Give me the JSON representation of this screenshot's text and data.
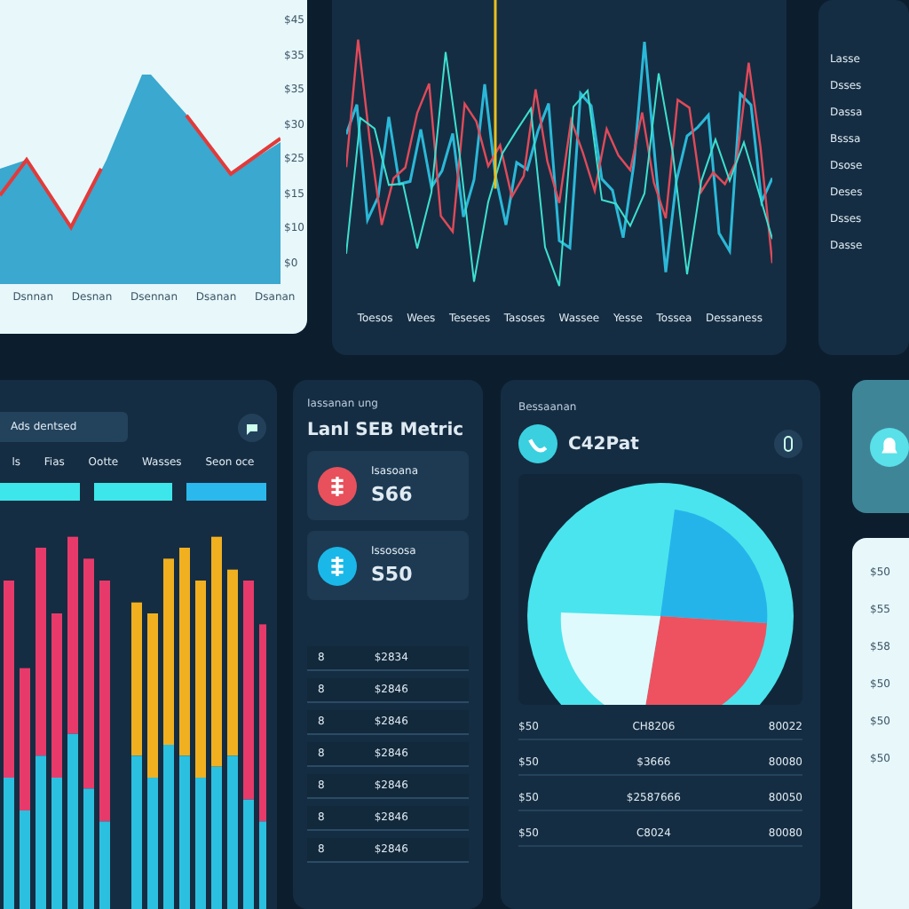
{
  "area_card": {
    "y_labels": [
      "$45",
      "$35",
      "$35",
      "$30",
      "$25",
      "$15",
      "$10",
      "$0"
    ],
    "x_labels": [
      "Dsnnan",
      "Desnan",
      "Dsennan",
      "Dsanan",
      "Dsanan"
    ]
  },
  "line_card": {
    "x_labels": [
      "Toesos",
      "Wees",
      "Teseses",
      "Tasoses",
      "Wassee",
      "Yesse",
      "Tossea",
      "Dessaness"
    ]
  },
  "side_list": {
    "items": [
      "Lasse",
      "Dsses",
      "Dassa",
      "Bsssa",
      "Dsose",
      "Deses",
      "Dsses",
      "Dasse"
    ]
  },
  "bars_card": {
    "header": "Ads dentsed",
    "legend": [
      "ls",
      "Fias",
      "Ootte",
      "Wasses",
      "Seon oce"
    ],
    "chips": [
      {
        "color": "#3de6ea"
      },
      {
        "color": "#3de6ea"
      },
      {
        "color": "#2bb8ec"
      }
    ]
  },
  "metric_card": {
    "caption": "Iassanan ung",
    "title": "Lanl SEB Metric",
    "metrics": [
      {
        "label": "Isasoana",
        "value": "S66",
        "color": "#e8505b"
      },
      {
        "label": "Issososa",
        "value": "S50",
        "color": "#1ab8e8"
      }
    ],
    "rows": [
      {
        "index": "8",
        "value": "$2834"
      },
      {
        "index": "8",
        "value": "$2846"
      },
      {
        "index": "8",
        "value": "$2846"
      },
      {
        "index": "8",
        "value": "$2846"
      },
      {
        "index": "8",
        "value": "$2846"
      },
      {
        "index": "8",
        "value": "$2846"
      },
      {
        "index": "8",
        "value": "$2846"
      }
    ]
  },
  "pie_card": {
    "caption": "Bessaanan",
    "title": "C42Pat",
    "rows": [
      {
        "c1": "$50",
        "c2": "CH8206",
        "c3": "80022"
      },
      {
        "c1": "$50",
        "c2": "$3666",
        "c3": "80080"
      },
      {
        "c1": "$50",
        "c2": "$2587666",
        "c3": "80050"
      },
      {
        "c1": "$50",
        "c2": "C8024",
        "c3": "80080"
      }
    ]
  },
  "axis_card": {
    "labels": [
      "$50",
      "$55",
      "$58",
      "$50",
      "$50",
      "$50"
    ]
  }
}
